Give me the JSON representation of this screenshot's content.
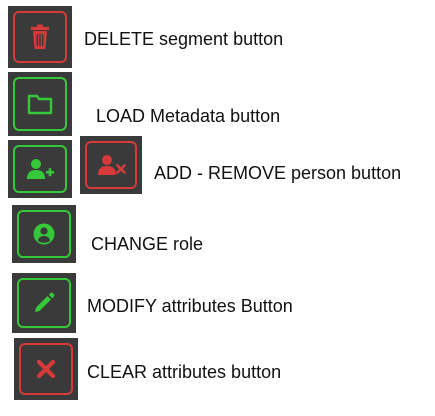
{
  "colors": {
    "button_bg": "#3a3a3a",
    "green": "#35c93a",
    "red": "#d63a3a"
  },
  "items": [
    {
      "label": "DELETE segment button",
      "icon": "trash-icon",
      "color": "red"
    },
    {
      "label": "LOAD Metadata button",
      "icon": "folder-icon",
      "color": "green"
    },
    {
      "label": "ADD - REMOVE person button",
      "icons": [
        "add-person-icon",
        "remove-person-icon"
      ],
      "colors": [
        "green",
        "red"
      ]
    },
    {
      "label": "CHANGE role",
      "icon": "user-circle-icon",
      "color": "green"
    },
    {
      "label": "MODIFY attributes Button",
      "icon": "pencil-icon",
      "color": "green"
    },
    {
      "label": "CLEAR attributes button",
      "icon": "close-x-icon",
      "color": "red"
    }
  ]
}
